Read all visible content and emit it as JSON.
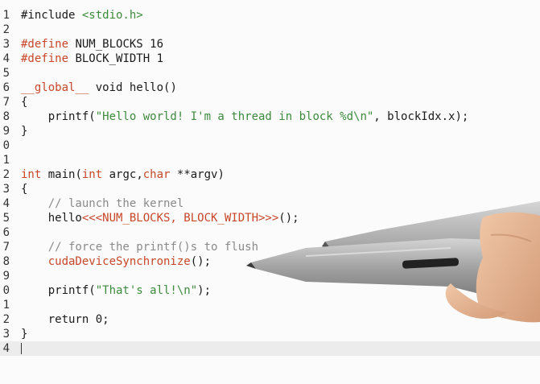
{
  "editor": {
    "current_line_index": 33,
    "lines": [
      {
        "no": "1",
        "tokens": [
          {
            "t": "#include ",
            "c": "pp"
          },
          {
            "t": "<stdio.h>",
            "c": "str"
          }
        ]
      },
      {
        "no": "2",
        "tokens": []
      },
      {
        "no": "3",
        "tokens": [
          {
            "t": "#define",
            "c": "kw"
          },
          {
            "t": " NUM_BLOCKS 16",
            "c": "plain"
          }
        ]
      },
      {
        "no": "4",
        "tokens": [
          {
            "t": "#define",
            "c": "kw"
          },
          {
            "t": " BLOCK_WIDTH 1",
            "c": "plain"
          }
        ]
      },
      {
        "no": "5",
        "tokens": []
      },
      {
        "no": "6",
        "tokens": [
          {
            "t": "__global__",
            "c": "kw"
          },
          {
            "t": " void hello()",
            "c": "plain"
          }
        ]
      },
      {
        "no": "7",
        "tokens": [
          {
            "t": "{",
            "c": "plain"
          }
        ]
      },
      {
        "no": "8",
        "tokens": [
          {
            "t": "    printf(",
            "c": "plain"
          },
          {
            "t": "\"Hello world! I'm a thread in block %d\\n\"",
            "c": "str"
          },
          {
            "t": ", blockIdx.x);",
            "c": "plain"
          }
        ]
      },
      {
        "no": "9",
        "tokens": [
          {
            "t": "}",
            "c": "plain"
          }
        ]
      },
      {
        "no": "0",
        "tokens": []
      },
      {
        "no": "1",
        "tokens": []
      },
      {
        "no": "2",
        "tokens": [
          {
            "t": "int",
            "c": "kw"
          },
          {
            "t": " main(",
            "c": "plain"
          },
          {
            "t": "int",
            "c": "kw"
          },
          {
            "t": " argc,",
            "c": "plain"
          },
          {
            "t": "char",
            "c": "kw"
          },
          {
            "t": " **argv)",
            "c": "plain"
          }
        ]
      },
      {
        "no": "3",
        "tokens": [
          {
            "t": "{",
            "c": "plain"
          }
        ]
      },
      {
        "no": "4",
        "tokens": [
          {
            "t": "    // launch the kernel",
            "c": "cm"
          }
        ]
      },
      {
        "no": "5",
        "tokens": [
          {
            "t": "    hello",
            "c": "plain"
          },
          {
            "t": "<<<NUM_BLOCKS, BLOCK_WIDTH>>>",
            "c": "kw"
          },
          {
            "t": "();",
            "c": "plain"
          }
        ]
      },
      {
        "no": "6",
        "tokens": []
      },
      {
        "no": "7",
        "tokens": [
          {
            "t": "    // force the printf()s to flush",
            "c": "cm"
          }
        ]
      },
      {
        "no": "8",
        "tokens": [
          {
            "t": "    cudaDeviceSynchronize",
            "c": "kw"
          },
          {
            "t": "();",
            "c": "plain"
          }
        ]
      },
      {
        "no": "9",
        "tokens": []
      },
      {
        "no": "0",
        "tokens": [
          {
            "t": "    printf(",
            "c": "plain"
          },
          {
            "t": "\"That's all!\\n\"",
            "c": "str"
          },
          {
            "t": ");",
            "c": "plain"
          }
        ]
      },
      {
        "no": "1",
        "tokens": []
      },
      {
        "no": "2",
        "tokens": [
          {
            "t": "    return ",
            "c": "plain"
          },
          {
            "t": "0",
            "c": "num"
          },
          {
            "t": ";",
            "c": "plain"
          }
        ]
      },
      {
        "no": "3",
        "tokens": [
          {
            "t": "}",
            "c": "plain"
          }
        ]
      },
      {
        "no": "4",
        "tokens": []
      }
    ]
  },
  "colors": {
    "keyword": "#c8462a",
    "string": "#3d8a3d",
    "comment": "#8a8a8a",
    "text": "#1a1a1a",
    "current_line": "#ececec"
  },
  "icons": {
    "pen": "stylus-pen-icon"
  }
}
